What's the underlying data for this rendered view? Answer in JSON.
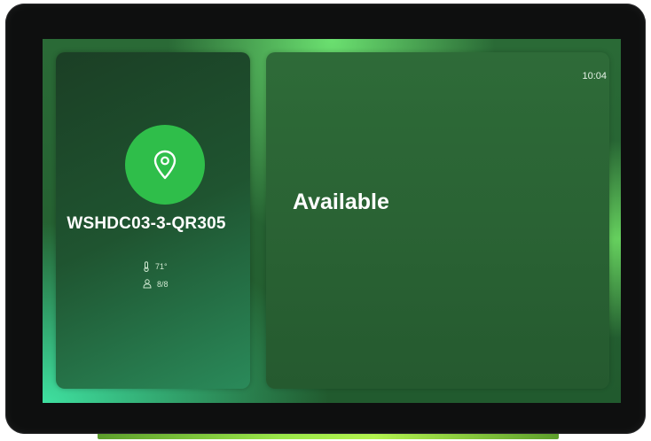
{
  "room": {
    "name": "WSHDC03-3-QR305",
    "temperature": "71°",
    "occupancy": "8/8"
  },
  "status": {
    "label": "Available"
  },
  "clock": {
    "time": "10:04"
  },
  "icons": {
    "location": "location-pin-icon",
    "temperature": "thermometer-icon",
    "occupancy": "person-icon"
  },
  "colors": {
    "accent": "#2fbe4a",
    "panel": "#2a6334",
    "glow": "#6be070"
  }
}
